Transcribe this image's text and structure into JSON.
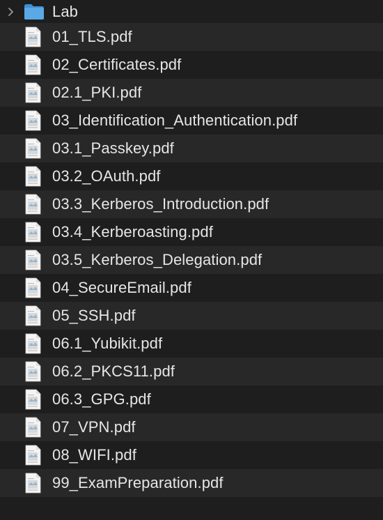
{
  "folder": {
    "name": "Lab",
    "icon": "folder-icon",
    "expanded": false,
    "accent_color": "#5aa9e6"
  },
  "files": [
    {
      "name": "01_TLS.pdf",
      "icon": "pdf-file-icon"
    },
    {
      "name": "02_Certificates.pdf",
      "icon": "pdf-file-icon"
    },
    {
      "name": "02.1_PKI.pdf",
      "icon": "pdf-file-icon"
    },
    {
      "name": "03_Identification_Authentication.pdf",
      "icon": "pdf-file-icon"
    },
    {
      "name": "03.1_Passkey.pdf",
      "icon": "pdf-file-icon"
    },
    {
      "name": "03.2_OAuth.pdf",
      "icon": "pdf-file-icon"
    },
    {
      "name": "03.3_Kerberos_Introduction.pdf",
      "icon": "pdf-file-icon"
    },
    {
      "name": "03.4_Kerberoasting.pdf",
      "icon": "pdf-file-icon"
    },
    {
      "name": "03.5_Kerberos_Delegation.pdf",
      "icon": "pdf-file-icon"
    },
    {
      "name": "04_SecureEmail.pdf",
      "icon": "pdf-file-icon"
    },
    {
      "name": "05_SSH.pdf",
      "icon": "pdf-file-icon"
    },
    {
      "name": "06.1_Yubikit.pdf",
      "icon": "pdf-file-icon"
    },
    {
      "name": "06.2_PKCS11.pdf",
      "icon": "pdf-file-icon"
    },
    {
      "name": "06.3_GPG.pdf",
      "icon": "pdf-file-icon"
    },
    {
      "name": "07_VPN.pdf",
      "icon": "pdf-file-icon"
    },
    {
      "name": "08_WIFI.pdf",
      "icon": "pdf-file-icon"
    },
    {
      "name": "99_ExamPreparation.pdf",
      "icon": "pdf-file-icon"
    }
  ],
  "colors": {
    "background": "#1e1e1e",
    "alt_row": "#282828",
    "text": "#e6e6e6"
  }
}
